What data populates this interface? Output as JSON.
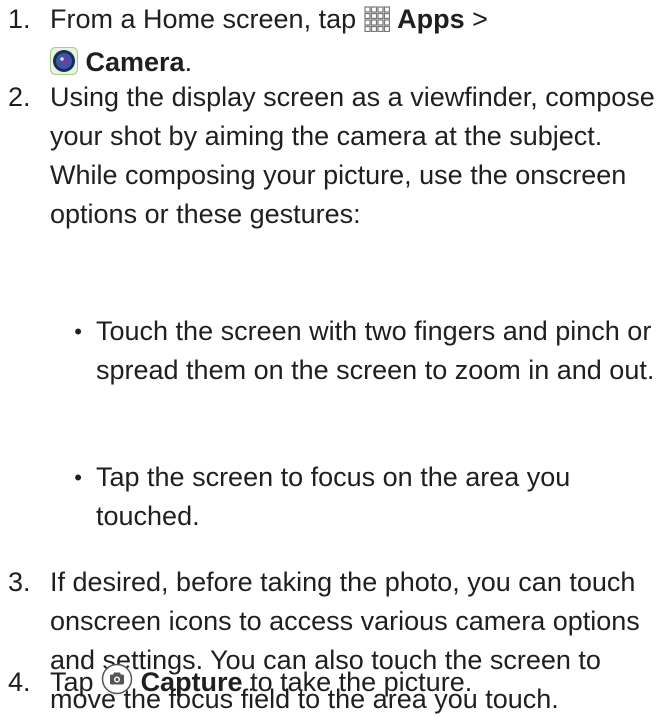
{
  "steps": [
    {
      "number": "1.",
      "prefix": "From a Home screen, tap ",
      "apps": "Apps",
      "sep": " >",
      "camera": "Camera",
      "suffix": ".",
      "apps_icon": "apps-grid-icon",
      "camera_icon": "camera-app-icon"
    },
    {
      "number": "2.",
      "text": "Using the display screen as a viewfinder, compose your shot by aiming the camera at the subject. While composing your picture, use the onscreen options or these gestures:",
      "bullets": [
        "Touch the screen with two fingers and pinch or spread them on the screen to zoom in and out.",
        "Tap the screen to focus on the area you touched."
      ]
    },
    {
      "number": "3.",
      "text": "If desired, before taking the photo, you can touch onscreen icons to access various camera options and settings. You can also touch the screen to move the focus field to the area you touch."
    },
    {
      "number": "4.",
      "prefix": "Tap ",
      "capture": "Capture",
      "suffix": " to take the picture.",
      "capture_icon": "capture-button-icon"
    }
  ]
}
